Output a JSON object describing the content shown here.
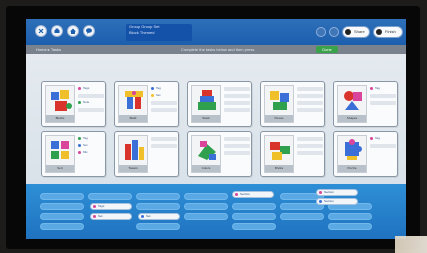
{
  "window": {
    "title_line1": "Group Group Set",
    "title_line2": "Block Themed"
  },
  "toolbar": {
    "left_buttons": [
      "close-icon",
      "print-icon",
      "home-icon",
      "chat-icon"
    ],
    "right_icons": [
      "info-icon",
      "help-icon"
    ],
    "share_label": "Share",
    "finish_label": "Finish"
  },
  "subbar": {
    "breadcrumb": "Home ▸ Tasks",
    "hint": "Complete the tasks below and then press",
    "go_label": "Done"
  },
  "cards": [
    {
      "caption": "Blocks",
      "labels": [
        "Tags",
        "Note"
      ]
    },
    {
      "caption": "Build",
      "labels": [
        "Tag",
        "Set"
      ]
    },
    {
      "caption": "Stack",
      "labels": []
    },
    {
      "caption": "Pieces",
      "labels": []
    },
    {
      "caption": "Shapes",
      "labels": [
        "Tag"
      ]
    },
    {
      "caption": "Sort",
      "labels": [
        "Tag",
        "Set",
        "Mix"
      ]
    },
    {
      "caption": "Towers",
      "labels": []
    },
    {
      "caption": "Colors",
      "labels": []
    },
    {
      "caption": "Bricks",
      "labels": []
    },
    {
      "caption": "Puzzle",
      "labels": [
        "Tag"
      ]
    }
  ],
  "tray": {
    "items": [
      "Tags",
      "Set",
      "Set",
      "Section",
      "Section",
      "Section"
    ]
  },
  "colors": {
    "titlebar": "#1c5fae",
    "tray": "#2479c5",
    "accent_pink": "#d8459a",
    "accent_green": "#3aa24a"
  }
}
